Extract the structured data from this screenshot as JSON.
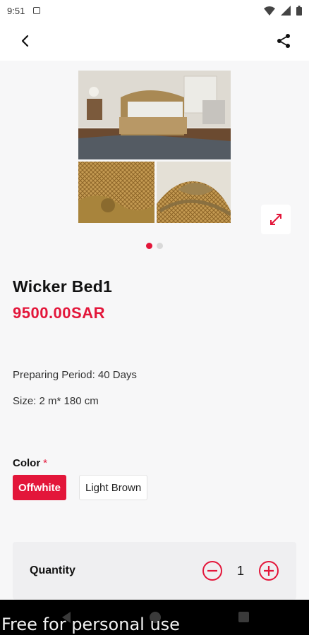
{
  "status_bar": {
    "time": "9:51"
  },
  "header": {
    "back_icon": "arrow-back-icon",
    "share_icon": "share-icon"
  },
  "gallery": {
    "images": [
      "bedroom-with-wicker-bed",
      "wicker-headboard-detail",
      "carved-wood-detail"
    ],
    "page_count": 2,
    "active_page": 1,
    "expand_icon": "expand-icon"
  },
  "product": {
    "title": "Wicker Bed1",
    "price": "9500.00SAR",
    "preparing_period": "Preparing Period: 40 Days",
    "size": "Size: 2 m* 180 cm"
  },
  "color": {
    "label": "Color",
    "required_mark": "*",
    "options": [
      {
        "label": "Offwhite",
        "selected": true
      },
      {
        "label": "Light Brown",
        "selected": false
      }
    ]
  },
  "quantity": {
    "label": "Quantity",
    "value": "1"
  },
  "colors": {
    "accent": "#e3163a",
    "background": "#f7f7f8"
  },
  "watermark": "Free for personal use"
}
